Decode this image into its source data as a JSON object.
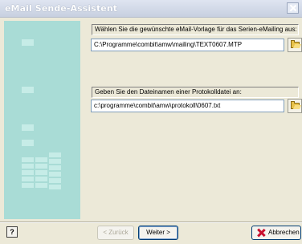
{
  "window": {
    "title": "eMail Sende-Assistent"
  },
  "step1": {
    "label": "Wählen Sie die gewünschte eMail-Vorlage für das Serien-eMailing aus:",
    "path": "C:\\Programme\\combit\\amw\\mailing\\TEXT0607.MTP"
  },
  "step2": {
    "label": "Geben Sie den Dateinamen einer Protokolldatei an:",
    "path": "c:\\programme\\combit\\amw\\protokoll\\0607.txt"
  },
  "buttons": {
    "help": "?",
    "back": "< Zurück",
    "next": "Weiter >",
    "cancel": "Abbrechen"
  },
  "icons": {
    "browse": "folder-open-icon",
    "cancel": "red-x-icon",
    "close": "close-icon"
  },
  "colors": {
    "sidebar": "#a9dcd6",
    "sidebar_marker": "#c6ece7",
    "dialog_bg": "#ece9d8"
  }
}
